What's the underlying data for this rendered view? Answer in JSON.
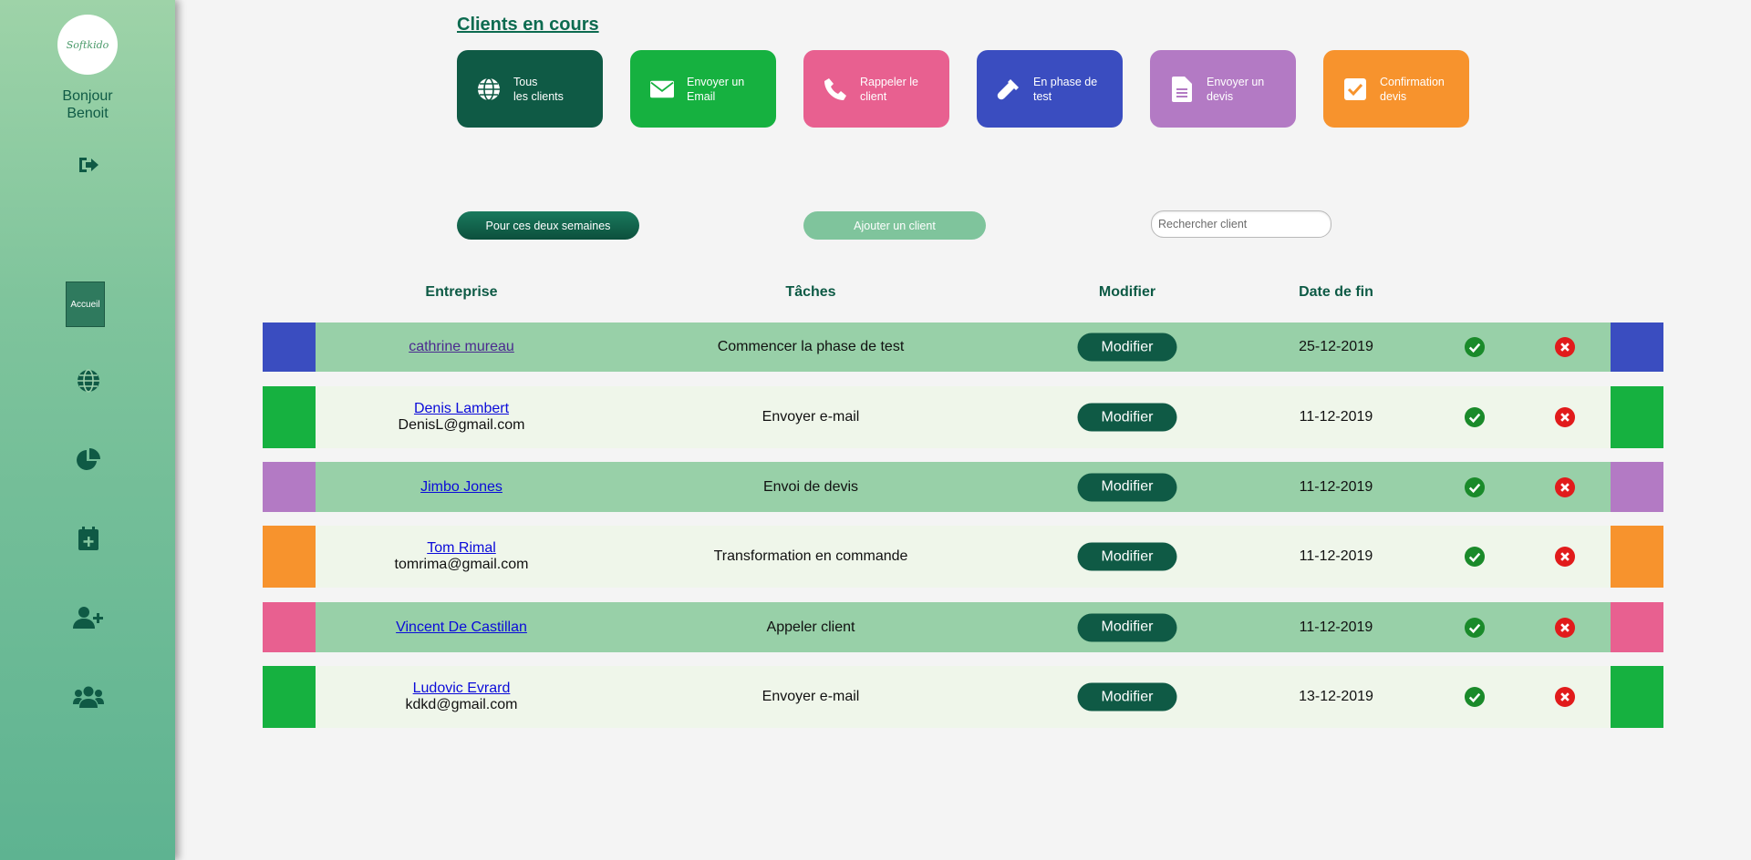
{
  "sidebar": {
    "logo_text": "Softkido",
    "greeting_line1": "Bonjour",
    "greeting_line2": "Benoit",
    "home_label": "Accueil"
  },
  "page": {
    "title": "Clients en cours"
  },
  "filters": [
    {
      "label": "Tous\nles clients",
      "color": "#0f5a45",
      "icon": "globe-icon"
    },
    {
      "label": "Envoyer un\nEmail",
      "color": "#16b140",
      "icon": "envelope-icon"
    },
    {
      "label": "Rappeler le\nclient",
      "color": "#e86090",
      "icon": "phone-icon"
    },
    {
      "label": "En phase de\ntest",
      "color": "#3a4dc0",
      "icon": "test-tube-icon"
    },
    {
      "label": "Envoyer un\ndevis",
      "color": "#b37ac4",
      "icon": "document-icon"
    },
    {
      "label": "Confirmation\ndevis",
      "color": "#f7932d",
      "icon": "check-square-icon"
    }
  ],
  "actions": {
    "two_weeks_label": "Pour ces deux semaines",
    "add_client_label": "Ajouter un client",
    "search_placeholder": "Rechercher client"
  },
  "table": {
    "headers": {
      "company": "Entreprise",
      "tasks": "Tâches",
      "edit": "Modifier",
      "end_date": "Date de fin"
    },
    "edit_button_label": "Modifier",
    "rows": [
      {
        "company": "cathrine mureau",
        "email": "",
        "task": "Commencer la phase de test",
        "date": "25-12-2019",
        "color": "#3a4dc0",
        "visited": true
      },
      {
        "company": "Denis Lambert",
        "email": "DenisL@gmail.com",
        "task": "Envoyer e-mail",
        "date": "11-12-2019",
        "color": "#16b140",
        "visited": false
      },
      {
        "company": "Jimbo Jones",
        "email": "",
        "task": "Envoi de devis",
        "date": "11-12-2019",
        "color": "#b37ac4",
        "visited": false
      },
      {
        "company": "Tom Rimal",
        "email": "tomrima@gmail.com",
        "task": "Transformation en commande",
        "date": "11-12-2019",
        "color": "#f7932d",
        "visited": false
      },
      {
        "company": "Vincent De Castillan",
        "email": "",
        "task": "Appeler client",
        "date": "11-12-2019",
        "color": "#e86090",
        "visited": false
      },
      {
        "company": "Ludovic Evrard",
        "email": "kdkd@gmail.com",
        "task": "Envoyer e-mail",
        "date": "13-12-2019",
        "color": "#16b140",
        "visited": false
      }
    ]
  },
  "colors": {
    "dark_green": "#0f5a45",
    "row_green": "#98d0a8",
    "row_light": "#eff6ea",
    "check_green": "#1a8a2a",
    "cross_red": "#e11b1b"
  }
}
